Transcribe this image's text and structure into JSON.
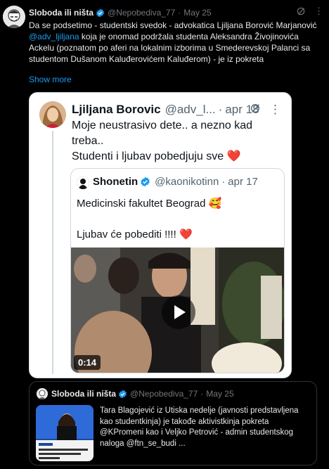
{
  "tweet": {
    "author_name": "Sloboda ili ništa",
    "handle": "@Nepobediva_77",
    "date": "May 25",
    "text_parts": {
      "p1": "Da se podsetimo - studentski svedok - advokatica Ljiljana Borović Marjanović ",
      "mention": "@adv_ljiljana",
      "p2": " koja je onomad podržala studenta Aleksandra Živojinovića Ackelu (poznatom po aferi na lokalnim izborima u Smederevskoj Palanci sa studentom Dušanom Kaluđerovićem Kaluđerom) - je iz pokreta"
    },
    "show_more": "Show more",
    "sep": "·"
  },
  "card1": {
    "author_name": "Ljiljana Borovic",
    "handle": "@adv_l...",
    "date": "apr 18",
    "line1": "Moje neustrasivo dete.. a nezno kad treba..",
    "line2": "Studenti i ljubav pobedjuju sve",
    "emoji2": "❤️",
    "more": "⋮"
  },
  "card2": {
    "author_name": "Shonetin",
    "handle": "@kaonikotinn",
    "date": "apr 17",
    "line1": "Medicinski fakultet Beograd",
    "emoji1": "🥰",
    "line2": "Ljubav će pobediti !!!!",
    "emoji2": "❤️",
    "duration": "0:14"
  },
  "quote": {
    "author_name": "Sloboda ili ništa",
    "handle": "@Nepobediva_77",
    "date": "May 25",
    "text": "Tara Blagojević iz Utiska nedelje (javnosti predstavljena kao studentkinja) je takođe aktivistkinja pokreta @KPromeni kao i Veljko Petrović - admin studentskog naloga @ftn_se_budi ..."
  },
  "colors": {
    "accent": "#1d9bf0",
    "muted": "#71767b",
    "verified": "#1d9bf0"
  },
  "icons": [
    "grok-icon",
    "more-icon",
    "verified-icon",
    "play-icon"
  ]
}
